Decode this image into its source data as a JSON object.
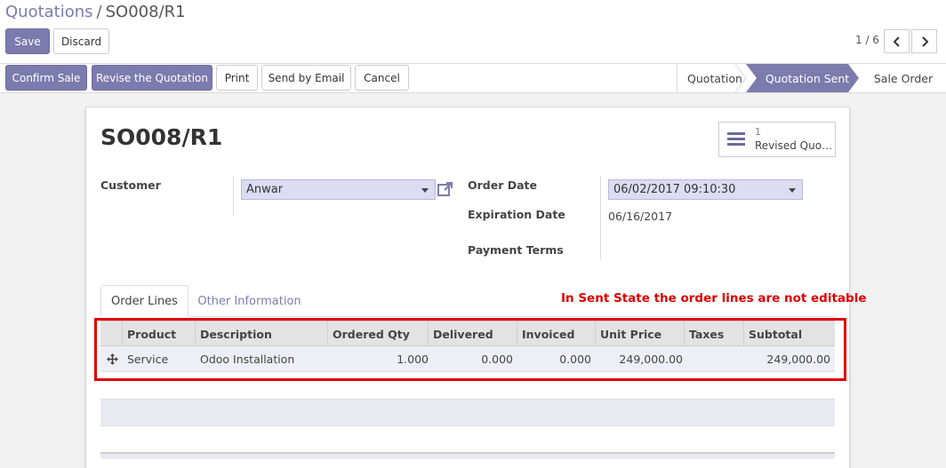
{
  "breadcrumb": {
    "parent": "Quotations",
    "separator": "/",
    "current": "SO008/R1"
  },
  "actions": {
    "save": "Save",
    "discard": "Discard"
  },
  "pager": {
    "value": "1 / 6"
  },
  "statusbar": {
    "buttons": [
      "Confirm Sale",
      "Revise the Quotation",
      "Print",
      "Send by Email",
      "Cancel"
    ],
    "steps": [
      "Quotation",
      "Quotation Sent",
      "Sale Order"
    ],
    "active_step": "Quotation Sent"
  },
  "record": {
    "title": "SO008/R1"
  },
  "smart_button": {
    "count": "1",
    "label": "Revised Quo…"
  },
  "fields": {
    "customer_label": "Customer",
    "customer_value": "Anwar",
    "order_date_label": "Order Date",
    "order_date_value": "06/02/2017 09:10:30",
    "expiration_label": "Expiration Date",
    "expiration_value": "06/16/2017",
    "payment_terms_label": "Payment Terms"
  },
  "tabs": [
    "Order Lines",
    "Other Information"
  ],
  "annotation": "In Sent State the order lines are not editable",
  "order_lines": {
    "columns": [
      "Product",
      "Description",
      "Ordered Qty",
      "Delivered",
      "Invoiced",
      "Unit Price",
      "Taxes",
      "Subtotal"
    ],
    "rows": [
      {
        "product": "Service",
        "description": "Odoo Installation",
        "ordered_qty": "1.000",
        "delivered": "0.000",
        "invoiced": "0.000",
        "unit_price": "249,000.00",
        "taxes": "",
        "subtotal": "249,000.00"
      }
    ]
  },
  "colors": {
    "primary": "#7c7bad",
    "annotation_red": "#e00000"
  }
}
